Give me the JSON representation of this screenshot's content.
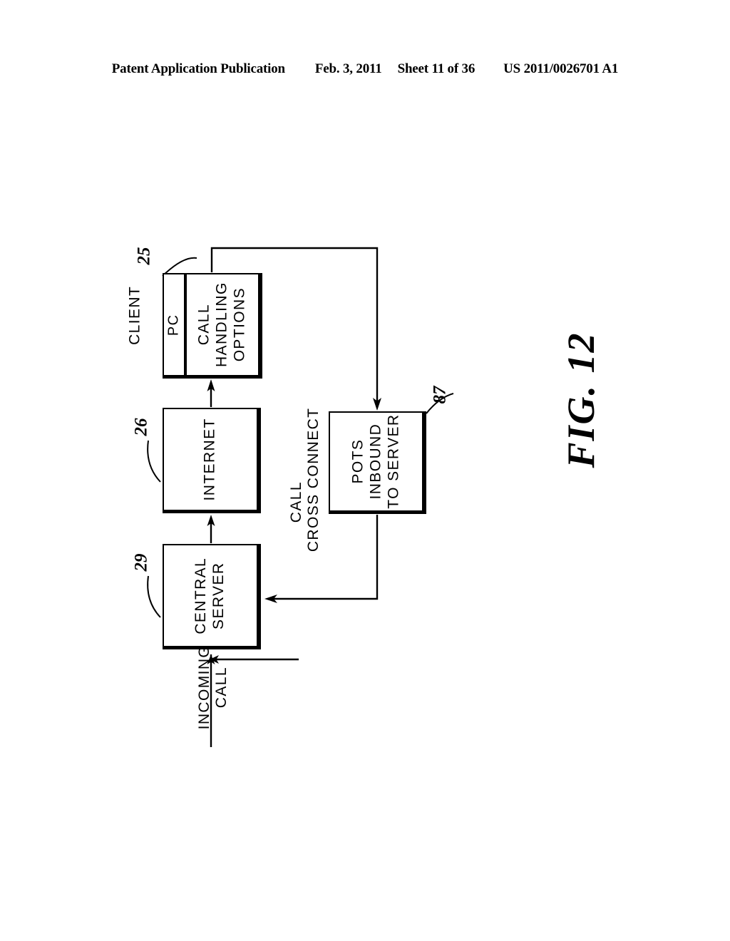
{
  "header": {
    "publication": "Patent Application Publication",
    "date": "Feb. 3, 2011",
    "sheet": "Sheet 11 of 36",
    "patent_number": "US 2011/0026701 A1"
  },
  "figure": {
    "caption": "FIG. 12",
    "orientation": "rotated-90-ccw"
  },
  "diagram": {
    "type": "block-flow-diagram",
    "blocks": [
      {
        "id": "client",
        "ref": "25",
        "caption": "CLIENT",
        "cells": [
          {
            "id": "pc",
            "label": "PC"
          },
          {
            "id": "call_handling_options",
            "label": "CALL\nHANDLING\nOPTIONS",
            "line1": "CALL",
            "line2": "HANDLING",
            "line3": "OPTIONS"
          }
        ]
      },
      {
        "id": "internet",
        "ref": "26",
        "label": "INTERNET"
      },
      {
        "id": "central_server",
        "ref": "29",
        "label": "CENTRAL\nSERVER",
        "line1": "CENTRAL",
        "line2": "SERVER"
      },
      {
        "id": "pots",
        "ref": "87",
        "label": "POTS\nINBOUND\nTO SERVER",
        "line1": "POTS",
        "line2": "INBOUND",
        "line3": "TO SERVER"
      }
    ],
    "edge_labels": {
      "incoming_call_line1": "INCOMING",
      "incoming_call_line2": "CALL",
      "call_cross_connect_line1": "CALL",
      "call_cross_connect_line2": "CROSS CONNECT"
    },
    "connections": [
      {
        "from": "incoming-call",
        "to": "central_server",
        "style": "solid-arrow"
      },
      {
        "from": "central_server",
        "to": "internet",
        "style": "solid-arrow"
      },
      {
        "from": "internet",
        "to": "client",
        "style": "solid-arrow"
      },
      {
        "from": "client",
        "to": "pots",
        "style": "solid-arrow-elbow"
      },
      {
        "from": "pots",
        "to": "central_server",
        "style": "solid-arrow-elbow",
        "label": "CALL CROSS CONNECT"
      }
    ]
  },
  "colors": {
    "ink": "#000000",
    "paper": "#ffffff"
  }
}
